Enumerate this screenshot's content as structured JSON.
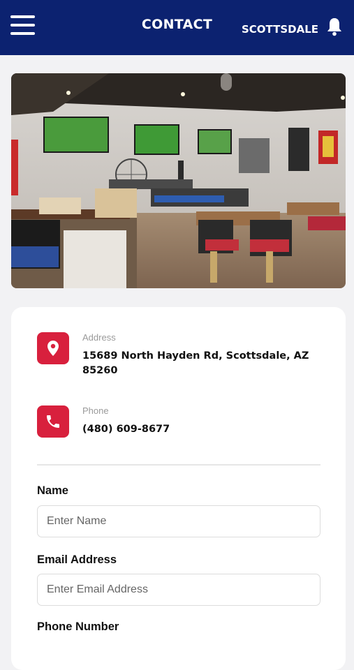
{
  "header": {
    "title": "CONTACT",
    "location": "SCOTTSDALE",
    "bg_color": "#0c2270",
    "menu_icon": "hamburger-menu-icon",
    "bell_icon": "bell-icon"
  },
  "hero_image": {
    "alt": "Restaurant interior"
  },
  "contact": {
    "address_label": "Address",
    "address_value": "15689 North Hayden Rd, Scottsdale, AZ 85260",
    "phone_label": "Phone",
    "phone_value": "(480) 609-8677",
    "accent_color": "#d8203d"
  },
  "form": {
    "name_label": "Name",
    "name_placeholder": "Enter Name",
    "email_label": "Email Address",
    "email_placeholder": "Enter Email Address",
    "phone_label": "Phone Number"
  }
}
